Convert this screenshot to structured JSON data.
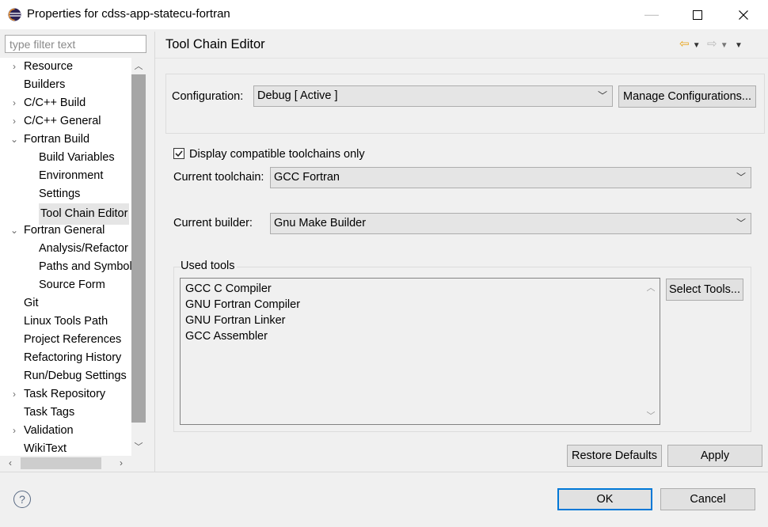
{
  "window": {
    "title": "Properties for cdss-app-statecu-fortran",
    "minimize_symbol": "—",
    "maximize_symbol": "☐",
    "close_symbol": "✕"
  },
  "filter": {
    "placeholder": "type filter text"
  },
  "tree": {
    "items": [
      {
        "label": "Resource",
        "arrow": "›"
      },
      {
        "label": "Builders",
        "arrow": ""
      },
      {
        "label": "C/C++ Build",
        "arrow": "›"
      },
      {
        "label": "C/C++ General",
        "arrow": "›"
      },
      {
        "label": "Fortran Build",
        "arrow": "⌄"
      },
      {
        "label": "Build Variables",
        "arrow": ""
      },
      {
        "label": "Environment",
        "arrow": ""
      },
      {
        "label": "Settings",
        "arrow": ""
      },
      {
        "label": "Tool Chain Editor",
        "arrow": ""
      },
      {
        "label": "Fortran General",
        "arrow": "⌄"
      },
      {
        "label": "Analysis/Refactor",
        "arrow": ""
      },
      {
        "label": "Paths and Symbol",
        "arrow": ""
      },
      {
        "label": "Source Form",
        "arrow": ""
      },
      {
        "label": "Git",
        "arrow": ""
      },
      {
        "label": "Linux Tools Path",
        "arrow": ""
      },
      {
        "label": "Project References",
        "arrow": ""
      },
      {
        "label": "Refactoring History",
        "arrow": ""
      },
      {
        "label": "Run/Debug Settings",
        "arrow": ""
      },
      {
        "label": "Task Repository",
        "arrow": "›"
      },
      {
        "label": "Task Tags",
        "arrow": ""
      },
      {
        "label": "Validation",
        "arrow": "›"
      },
      {
        "label": "WikiText",
        "arrow": ""
      }
    ],
    "selected": "Tool Chain Editor"
  },
  "page": {
    "title": "Tool Chain Editor",
    "configuration_label": "Configuration:",
    "configuration_value": "Debug  [ Active ]",
    "manage_button": "Manage Configurations...",
    "compatible_checkbox_label": "Display compatible toolchains only",
    "compatible_checked": true,
    "toolchain_label": "Current toolchain:",
    "toolchain_value": "GCC Fortran",
    "builder_label": "Current builder:",
    "builder_value": "Gnu Make Builder",
    "used_tools_title": "Used tools",
    "used_tools": [
      "GCC C Compiler",
      "GNU Fortran Compiler",
      "GNU Fortran Linker",
      "GCC Assembler"
    ],
    "select_tools_button": "Select Tools...",
    "restore_button": "Restore Defaults",
    "apply_button": "Apply"
  },
  "footer": {
    "help_symbol": "?",
    "ok_button": "OK",
    "cancel_button": "Cancel"
  },
  "colors": {
    "back_arrow": "#e8a317",
    "selection_bg": "#e5e5e5",
    "default_button_border": "#0078d7"
  }
}
